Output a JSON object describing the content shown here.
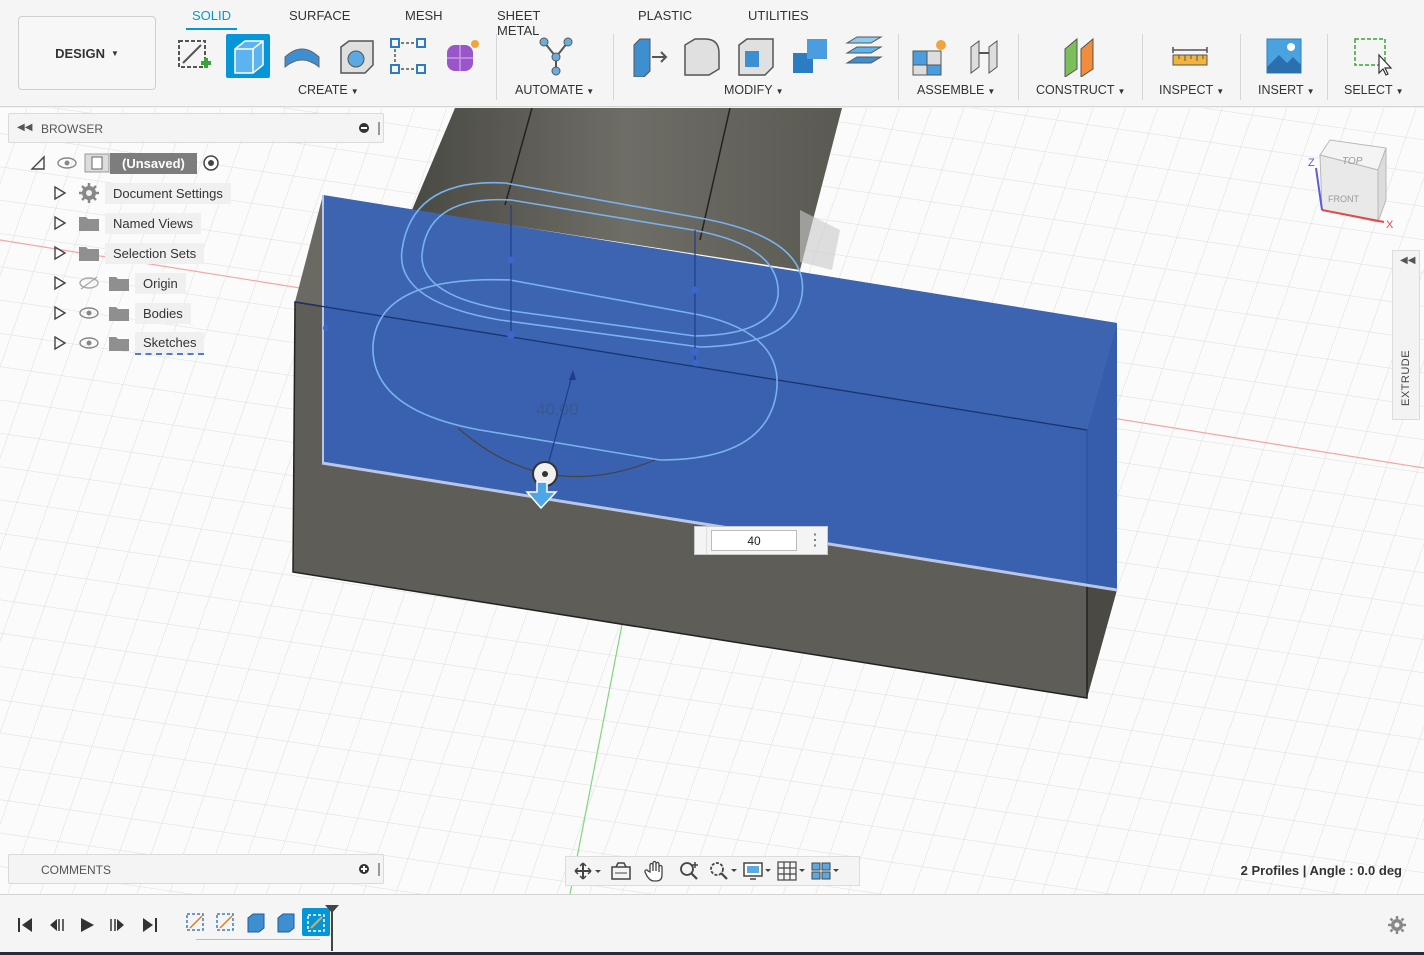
{
  "workspace": {
    "label": "DESIGN"
  },
  "tabs": [
    {
      "label": "SOLID",
      "active": true
    },
    {
      "label": "SURFACE"
    },
    {
      "label": "MESH"
    },
    {
      "label": "SHEET METAL"
    },
    {
      "label": "PLASTIC"
    },
    {
      "label": "UTILITIES"
    }
  ],
  "groups": {
    "create": "CREATE",
    "automate": "AUTOMATE",
    "modify": "MODIFY",
    "assemble": "ASSEMBLE",
    "construct": "CONSTRUCT",
    "inspect": "INSPECT",
    "insert": "INSERT",
    "select": "SELECT"
  },
  "browser": {
    "title": "BROWSER",
    "root": "(Unsaved)",
    "items": [
      {
        "label": "Document Settings",
        "icon": "gear-icon"
      },
      {
        "label": "Named Views",
        "icon": "folder-icon"
      },
      {
        "label": "Selection Sets",
        "icon": "folder-icon"
      },
      {
        "label": "Origin",
        "icon": "folder-icon",
        "hidden": true
      },
      {
        "label": "Bodies",
        "icon": "folder-icon"
      },
      {
        "label": "Sketches",
        "icon": "folder-icon"
      }
    ]
  },
  "comments": {
    "title": "COMMENTS"
  },
  "dimension": {
    "value": "40",
    "ghost_label": "40.00"
  },
  "viewcube": {
    "top": "TOP",
    "front": "FRONT",
    "x": "X",
    "z": "Z"
  },
  "side_panel": {
    "label": "EXTRUDE"
  },
  "status": {
    "text": "2 Profiles | Angle : 0.0 deg"
  },
  "colors": {
    "accent": "#0696d7",
    "extrude": "#2f63c8",
    "body": "#5e5d58"
  }
}
